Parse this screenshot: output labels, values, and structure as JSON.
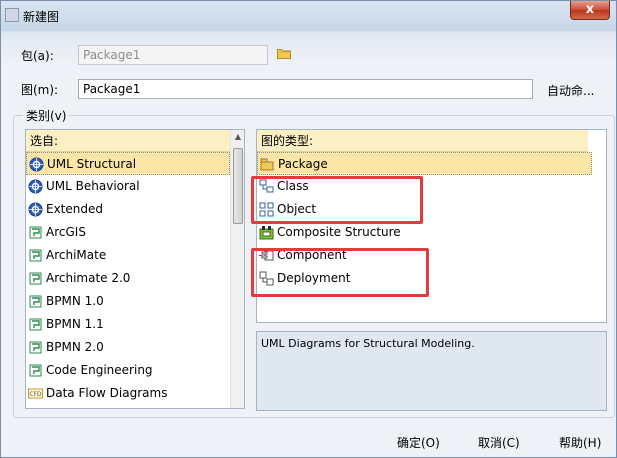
{
  "window": {
    "title": "新建图",
    "close_label": "x"
  },
  "package": {
    "label": "包(a):",
    "value": "Package1"
  },
  "diagram": {
    "label": "图(m):",
    "value": "Package1",
    "auto_name_label": "自动命..."
  },
  "category_group": {
    "label": "类别(v)"
  },
  "left_list": {
    "header": "选自:",
    "items": [
      {
        "label": "UML Structural",
        "icon": "uml-icon",
        "selected": true
      },
      {
        "label": "UML Behavioral",
        "icon": "uml-icon"
      },
      {
        "label": "Extended",
        "icon": "uml-icon"
      },
      {
        "label": "ArcGIS",
        "icon": "technology-icon"
      },
      {
        "label": "ArchiMate",
        "icon": "technology-icon"
      },
      {
        "label": "Archimate 2.0",
        "icon": "technology-icon"
      },
      {
        "label": "BPMN 1.0",
        "icon": "technology-icon"
      },
      {
        "label": "BPMN 1.1",
        "icon": "technology-icon"
      },
      {
        "label": "BPMN 2.0",
        "icon": "technology-icon"
      },
      {
        "label": "Code Engineering",
        "icon": "technology-icon"
      },
      {
        "label": "Data Flow Diagrams",
        "icon": "dfd-icon"
      }
    ]
  },
  "right_list": {
    "header": "图的类型:",
    "items": [
      {
        "label": "Package",
        "icon": "package-icon",
        "selected": true
      },
      {
        "label": "Class",
        "icon": "class-diagram-icon"
      },
      {
        "label": "Object",
        "icon": "object-diagram-icon"
      },
      {
        "label": "Composite Structure",
        "icon": "composite-structure-icon"
      },
      {
        "label": "Component",
        "icon": "component-diagram-icon"
      },
      {
        "label": "Deployment",
        "icon": "deployment-diagram-icon"
      }
    ]
  },
  "description": "UML Diagrams for Structural Modeling.",
  "buttons": {
    "ok": "确定(O)",
    "cancel": "取消(C)",
    "help": "帮助(H)"
  },
  "colors": {
    "highlight_box": "#e23b3b",
    "selection": "#fbe6a8",
    "header": "#fbefc4"
  }
}
